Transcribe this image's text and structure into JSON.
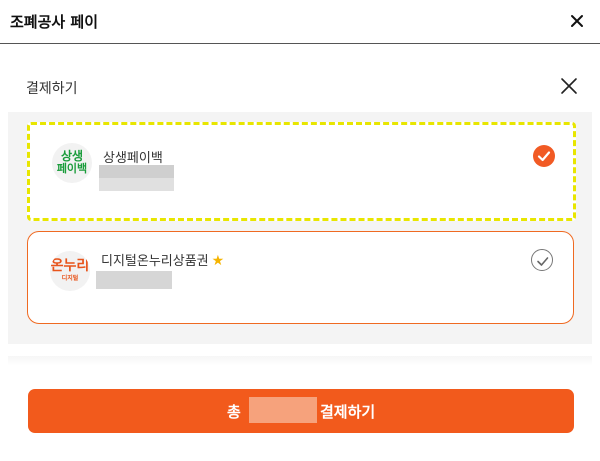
{
  "topbar": {
    "title": "조폐공사 페이"
  },
  "sheet": {
    "title": "결제하기"
  },
  "payment_methods": [
    {
      "name": "상생페이백",
      "logo_line1": "상생",
      "logo_line2": "페이백",
      "selected": true
    },
    {
      "name": "디지털온누리상품권",
      "logo_line1": "온누리",
      "logo_line2": "디지털",
      "selected": false
    }
  ],
  "pay_button": {
    "prefix": "총",
    "suffix": "결제하기"
  },
  "colors": {
    "accent": "#f25a1c",
    "highlight": "#e8e600",
    "brand_green": "#1a9c3b"
  }
}
